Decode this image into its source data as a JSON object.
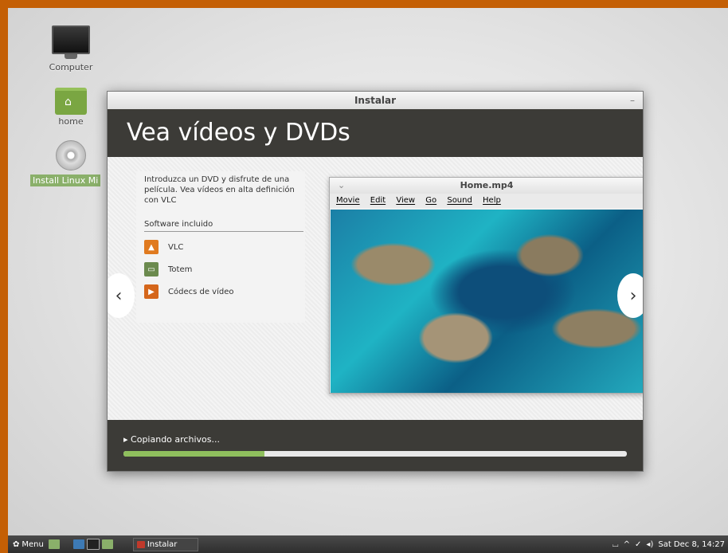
{
  "desktop": {
    "icons": [
      {
        "label": "Computer"
      },
      {
        "label": "home"
      },
      {
        "label": "Install Linux Mi"
      }
    ]
  },
  "window": {
    "title": "Instalar",
    "minimize": "–",
    "banner": "Vea vídeos y DVDs",
    "description": "Introduzca un DVD y disfrute de una película. Vea vídeos en alta definición con VLC",
    "software_title": "Software incluido",
    "software": [
      {
        "name": "VLC",
        "icon": "vlc-icon",
        "color": "#e07a1f"
      },
      {
        "name": "Totem",
        "icon": "totem-icon",
        "color": "#6b8a4e"
      },
      {
        "name": "Códecs de vídeo",
        "icon": "codecs-icon",
        "color": "#d5661b"
      }
    ],
    "nav_prev": "‹",
    "nav_next": "›",
    "status": "Copiando archivos...",
    "progress": 0.28
  },
  "player": {
    "title": "Home.mp4",
    "menu": [
      "Movie",
      "Edit",
      "View",
      "Go",
      "Sound",
      "Help"
    ]
  },
  "taskbar": {
    "menu_label": "Menu",
    "window_label": "Instalar",
    "clock": "Sat Dec  8, 14:27"
  },
  "colors": {
    "frame": "#c45f05",
    "banner_bg": "#3c3b37",
    "progress_fill": "#8fbf5d",
    "mint_green": "#8ab06a"
  }
}
